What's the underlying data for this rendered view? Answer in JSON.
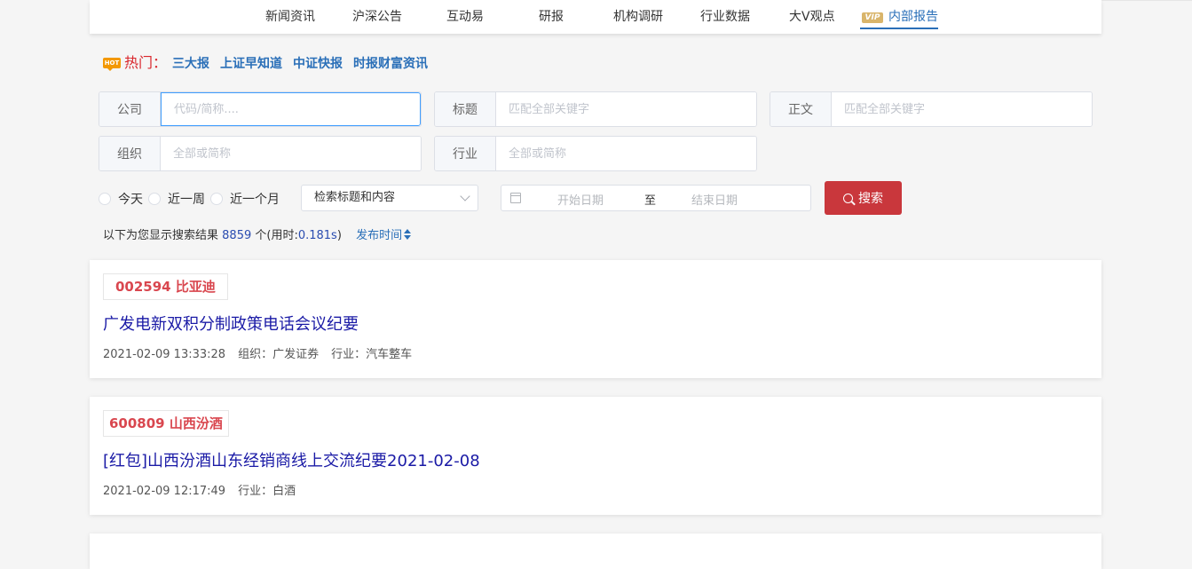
{
  "nav": {
    "items": [
      "新闻资讯",
      "沪深公告",
      "互动易",
      "研报",
      "机构调研",
      "行业数据",
      "大V观点"
    ],
    "vip_badge": "VIP",
    "vip_item": "内部报告"
  },
  "hot": {
    "icon_text": "HOT",
    "label": "热门：",
    "links": [
      "三大报",
      "上证早知道",
      "中证快报",
      "时报财富资讯"
    ]
  },
  "search": {
    "company_label": "公司",
    "company_placeholder": "代码/简称....",
    "title_label": "标题",
    "title_placeholder": "匹配全部关键字",
    "body_label": "正文",
    "body_placeholder": "匹配全部关键字",
    "org_label": "组织",
    "org_placeholder": "全部或简称",
    "industry_label": "行业",
    "industry_placeholder": "全部或简称",
    "radios": [
      "今天",
      "近一周",
      "近一个月"
    ],
    "scope_select": "检索标题和内容",
    "date_start": "开始日期",
    "date_sep": "至",
    "date_end": "结束日期",
    "button": "搜索"
  },
  "results": {
    "prefix": "以下为您显示搜索结果",
    "count": "8859",
    "suffix": "个(用时:",
    "time": "0.181s",
    "close": ")",
    "sort_label": "发布时间"
  },
  "cards": [
    {
      "stock": "002594 比亚迪",
      "title": "广发电新双积分制政策电话会议纪要",
      "datetime": "2021-02-09 13:33:28",
      "org": "组织：广发证券",
      "industry": "行业：汽车整车"
    },
    {
      "stock": "600809 山西汾酒",
      "title": "[红包]山西汾酒山东经销商线上交流纪要2021-02-08",
      "datetime": "2021-02-09 12:17:49",
      "industry": "行业：白酒"
    }
  ],
  "colors": {
    "accent": "#2a6fb8",
    "hot_red": "#d9262c",
    "search_button": "#c9373c",
    "stock_tag": "#d9474f",
    "title_blue": "#1a1aa6"
  }
}
